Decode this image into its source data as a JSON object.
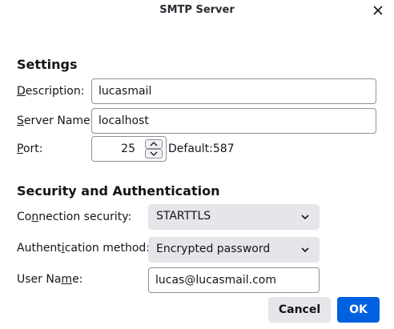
{
  "dialog": {
    "title": "SMTP Server"
  },
  "settings": {
    "heading": "Settings",
    "description": {
      "label_mnemonic": "D",
      "label_rest": "escription:",
      "value": "lucasmail"
    },
    "server_name": {
      "label_mnemonic": "S",
      "label_rest": "erver Name:",
      "value": "localhost"
    },
    "port": {
      "label_mnemonic": "P",
      "label_rest": "ort:",
      "value": "25",
      "default_text": "Default:587"
    }
  },
  "security": {
    "heading": "Security and Authentication",
    "connection": {
      "label_pre": "Co",
      "label_mnemonic": "n",
      "label_rest": "nection security:",
      "value": "STARTTLS"
    },
    "auth": {
      "label_pre": "Authent",
      "label_mnemonic": "i",
      "label_rest": "cation method:",
      "value": "Encrypted password"
    },
    "user": {
      "label_pre": "User Na",
      "label_mnemonic": "m",
      "label_rest": "e:",
      "value": "lucas@lucasmail.com"
    }
  },
  "buttons": {
    "cancel": "Cancel",
    "ok": "OK"
  },
  "colors": {
    "accent": "#0061e0",
    "button_bg": "#e6e6ea",
    "border": "#8f8f9d"
  },
  "icons": {
    "close": "close-icon",
    "chevron": "chevron-down-icon",
    "spin_up": "chevron-up-icon",
    "spin_down": "chevron-down-icon"
  }
}
